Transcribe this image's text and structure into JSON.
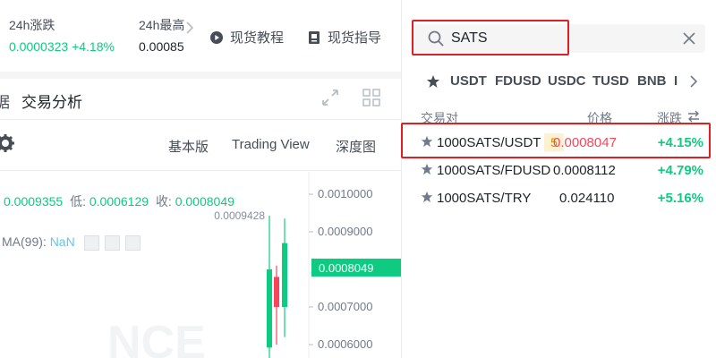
{
  "ticker": {
    "change_label": "24h涨跌",
    "change_value": "0.0000323 +4.18%",
    "high_label": "24h最高",
    "high_value": "0.00085"
  },
  "guides": {
    "tutorial": "现货教程",
    "guide": "现货指导"
  },
  "chart_tabs": {
    "partial_left": "据",
    "analysis": "交易分析"
  },
  "chart_views": {
    "basic": "基本版",
    "trading_view": "Trading View",
    "depth": "深度图"
  },
  "ohlc": {
    "high_value": "0.0009355",
    "low_label": "低:",
    "low_value": "0.0006129",
    "close_label": "收:",
    "close_value": "0.0008049"
  },
  "ma": {
    "label": "MA(99):",
    "value": "NaN"
  },
  "chart_data": {
    "type": "candlestick",
    "y_ticks": [
      "0.0010000",
      "0.0009000",
      "0.0007000",
      "0.0006000"
    ],
    "current_price": "0.0008049",
    "high_marker": "0.0009428",
    "watermark": "NCE",
    "candles": [
      {
        "open": 0.000592,
        "close": 0.0008,
        "low": 0.00056,
        "high": 0.000943,
        "up": true
      },
      {
        "open": 0.00078,
        "close": 0.0007,
        "low": 0.0006,
        "high": 0.00081,
        "up": false
      },
      {
        "open": 0.0007,
        "close": 0.00087,
        "low": 0.00062,
        "high": 0.000935,
        "up": true
      }
    ],
    "ylim": [
      0.00055,
      0.00105
    ],
    "colors": {
      "up": "#0ecb81",
      "down": "#f6465d"
    }
  },
  "search": {
    "value": "SATS"
  },
  "quote_tabs": [
    "USDT",
    "FDUSD",
    "USDC",
    "TUSD",
    "BNB",
    "I"
  ],
  "columns": {
    "pair": "交易对",
    "price": "价格",
    "change": "涨跌"
  },
  "pairs": [
    {
      "name": "1000SATS/USDT",
      "badge": "5",
      "price": "0.0008047",
      "change": "+4.15%"
    },
    {
      "name": "1000SATS/FDUSD",
      "price": "0.0008112",
      "change": "+4.79%"
    },
    {
      "name": "1000SATS/TRY",
      "price": "0.024110",
      "change": "+5.16%"
    }
  ],
  "colors": {
    "up": "#0ecb81",
    "down": "#f6465d",
    "accent": "#c99400",
    "highlight": "#e02020"
  }
}
